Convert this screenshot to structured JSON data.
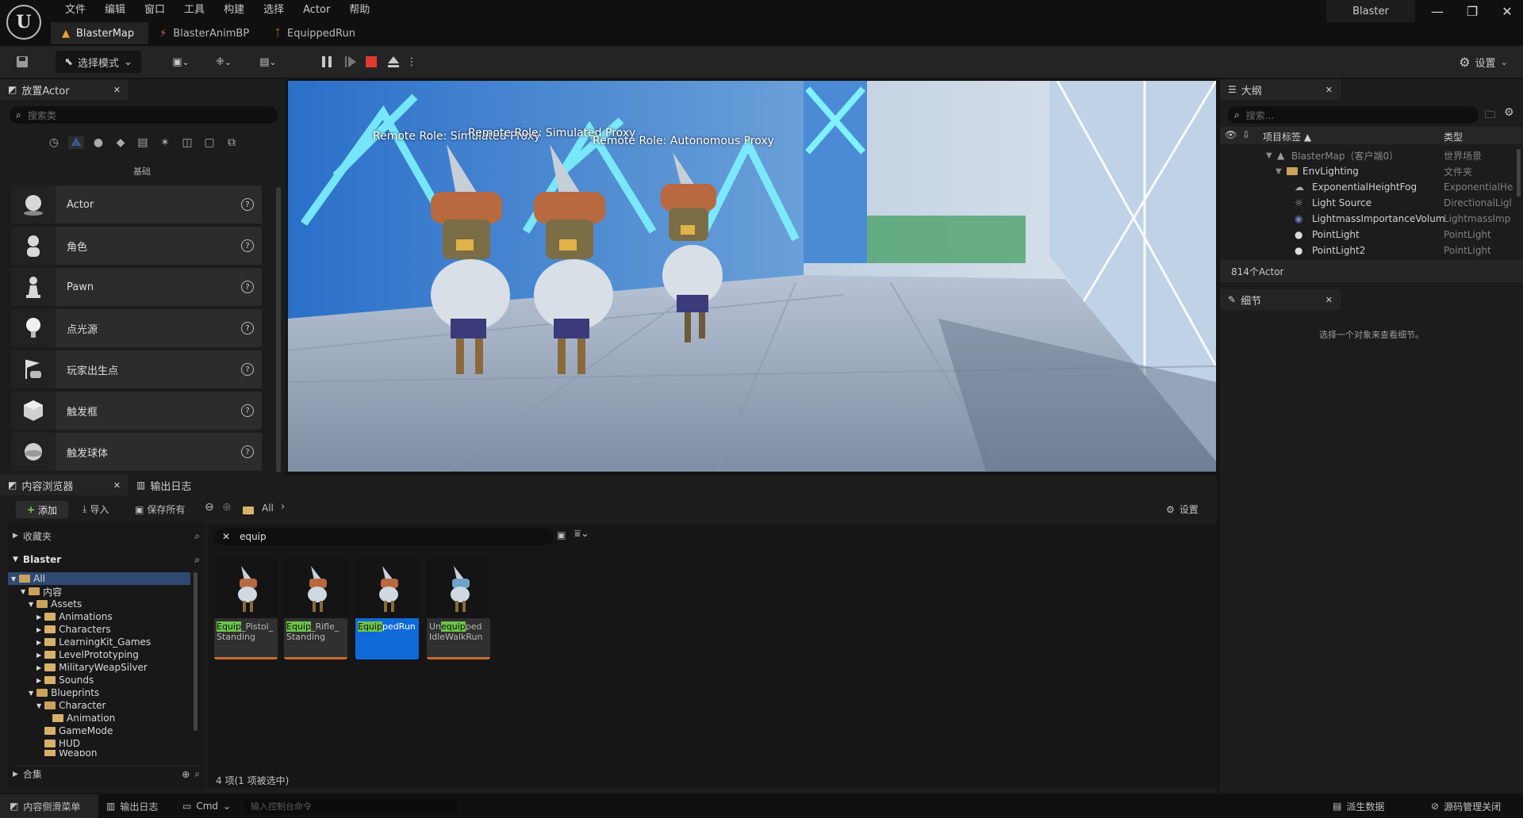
{
  "menu": [
    "文件",
    "编辑",
    "窗口",
    "工具",
    "构建",
    "选择",
    "Actor",
    "帮助"
  ],
  "doc_tabs": [
    "BlasterMap",
    "BlasterAnimBP",
    "EquippedRun"
  ],
  "project_name": "Blaster",
  "toolbar": {
    "mode_label": "选择模式",
    "settings_label": "设置"
  },
  "place_actors": {
    "tab_label": "放置Actor",
    "search_placeholder": "搜索类",
    "category_label": "基础",
    "items": [
      {
        "label": "Actor",
        "icon": "sphere-icon"
      },
      {
        "label": "角色",
        "icon": "character-icon"
      },
      {
        "label": "Pawn",
        "icon": "pawn-icon"
      },
      {
        "label": "点光源",
        "icon": "point-light-icon"
      },
      {
        "label": "玩家出生点",
        "icon": "player-start-icon"
      },
      {
        "label": "触发框",
        "icon": "trigger-box-icon"
      },
      {
        "label": "触发球体",
        "icon": "trigger-sphere-icon"
      }
    ]
  },
  "viewport": {
    "labels": [
      "Remote Role: Simulated Proxy",
      "Remote Role: Simulated Proxy",
      "Remote Role: Autonomous Proxy"
    ]
  },
  "outliner": {
    "tab_label": "大纲",
    "search_placeholder": "搜索...",
    "col_label": "项目标签 ▲",
    "col_type": "类型",
    "rows": [
      {
        "name": "BlasterMap（客户端0）",
        "type": "世界场景"
      },
      {
        "name": "EnvLighting",
        "type": "文件夹"
      },
      {
        "name": "ExponentialHeightFog",
        "type": "ExponentialHe"
      },
      {
        "name": "Light Source",
        "type": "DirectionalLigl"
      },
      {
        "name": "LightmassImportanceVolum",
        "type": "LightmassImp"
      },
      {
        "name": "PointLight",
        "type": "PointLight"
      },
      {
        "name": "PointLight2",
        "type": "PointLight"
      }
    ],
    "actor_count": "814个Actor"
  },
  "details": {
    "tab_label": "细节",
    "empty_message": "选择一个对象来查看细节。"
  },
  "content_browser": {
    "tab_label": "内容浏览器",
    "output_tab_label": "输出日志",
    "add_label": "添加",
    "import_label": "导入",
    "save_all_label": "保存所有",
    "path_label": "All",
    "settings_label": "设置",
    "favorites_label": "收藏夹",
    "root_label": "Blaster",
    "collections_label": "合集",
    "search_value": "equip",
    "tree": [
      "All",
      "内容",
      "Assets",
      "Animations",
      "Characters",
      "LearningKit_Games",
      "LevelPrototyping",
      "MilitaryWeapSilver",
      "Sounds",
      "Blueprints",
      "Character",
      "Animation",
      "GameMode",
      "HUD",
      "Weapon"
    ],
    "assets": [
      {
        "pre": "",
        "match": "Equip",
        "post": "_Pistol_",
        "line2": "Standing"
      },
      {
        "pre": "",
        "match": "Equip",
        "post": "_Rifle_",
        "line2": "Standing"
      },
      {
        "pre": "",
        "match": "Equip",
        "post": "pedRun",
        "line2": ""
      },
      {
        "pre": "Un",
        "match": "equip",
        "post": "ped",
        "line2": "IdleWalkRun"
      }
    ],
    "item_count": "4 项(1 项被选中)"
  },
  "statusbar": {
    "content_drawer": "内容侧滑菜单",
    "output_log": "输出日志",
    "cmd_label": "Cmd",
    "console_placeholder": "输入控制台命令",
    "derived_data": "派生数据",
    "source_control": "源码管理关闭"
  }
}
